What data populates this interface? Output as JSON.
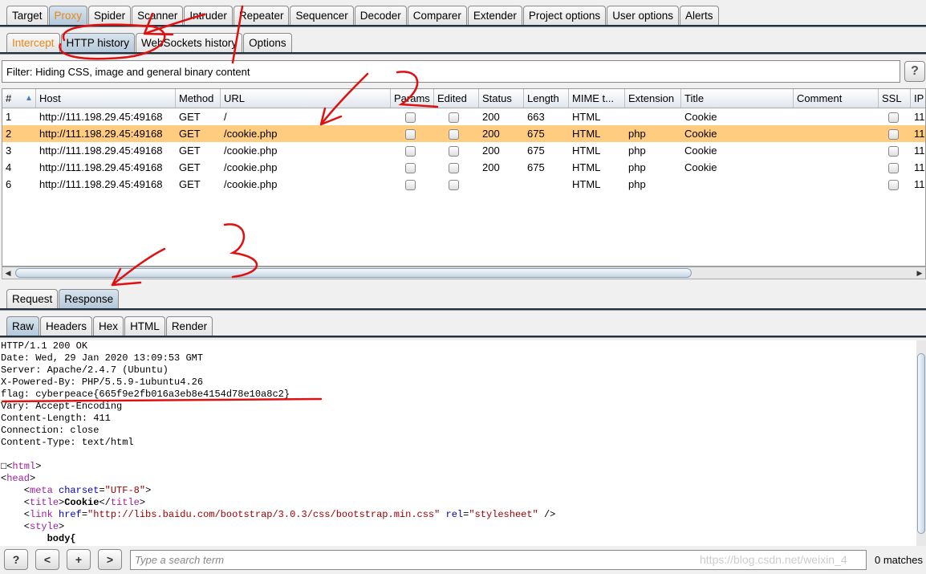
{
  "main_tabs": [
    "Target",
    "Proxy",
    "Spider",
    "Scanner",
    "Intruder",
    "Repeater",
    "Sequencer",
    "Decoder",
    "Comparer",
    "Extender",
    "Project options",
    "User options",
    "Alerts"
  ],
  "proxy_tabs": [
    "Intercept",
    "HTTP history",
    "WebSockets history",
    "Options"
  ],
  "filter": "Filter: Hiding CSS, image and general binary content",
  "help": "?",
  "columns": [
    "#",
    "Host",
    "Method",
    "URL",
    "Params",
    "Edited",
    "Status",
    "Length",
    "MIME t...",
    "Extension",
    "Title",
    "Comment",
    "SSL",
    "IP"
  ],
  "sort_indicator": "▲",
  "rows": [
    {
      "num": "1",
      "host": "http://111.198.29.45:49168",
      "method": "GET",
      "url": "/",
      "status": "200",
      "length": "663",
      "mime": "HTML",
      "ext": "",
      "title": "Cookie",
      "ip": "11"
    },
    {
      "num": "2",
      "host": "http://111.198.29.45:49168",
      "method": "GET",
      "url": "/cookie.php",
      "status": "200",
      "length": "675",
      "mime": "HTML",
      "ext": "php",
      "title": "Cookie",
      "ip": "11"
    },
    {
      "num": "3",
      "host": "http://111.198.29.45:49168",
      "method": "GET",
      "url": "/cookie.php",
      "status": "200",
      "length": "675",
      "mime": "HTML",
      "ext": "php",
      "title": "Cookie",
      "ip": "11"
    },
    {
      "num": "4",
      "host": "http://111.198.29.45:49168",
      "method": "GET",
      "url": "/cookie.php",
      "status": "200",
      "length": "675",
      "mime": "HTML",
      "ext": "php",
      "title": "Cookie",
      "ip": "11"
    },
    {
      "num": "6",
      "host": "http://111.198.29.45:49168",
      "method": "GET",
      "url": "/cookie.php",
      "status": "",
      "length": "",
      "mime": "HTML",
      "ext": "php",
      "title": "",
      "ip": "11"
    }
  ],
  "selected_row": 1,
  "msg_tabs": [
    "Request",
    "Response"
  ],
  "view_tabs": [
    "Raw",
    "Headers",
    "Hex",
    "HTML",
    "Render"
  ],
  "response_headers": [
    "HTTP/1.1 200 OK",
    "Date: Wed, 29 Jan 2020 13:09:53 GMT",
    "Server: Apache/2.4.7 (Ubuntu)",
    "X-Powered-By: PHP/5.5.9-1ubuntu4.26",
    "flag: cyberpeace{665f9e2fb016a3eb8e4154d78e10a8c2}",
    "Vary: Accept-Encoding",
    "Content-Length: 411",
    "Connection: close",
    "Content-Type: text/html"
  ],
  "body": {
    "html": "html",
    "head": "head",
    "meta": "meta",
    "charset": "charset",
    "utf8": "\"UTF-8\"",
    "title": "title",
    "title_text": "Cookie",
    "link": "link",
    "href": "href",
    "href_val": "\"http://libs.baidu.com/bootstrap/3.0.3/css/bootstrap.min.css\"",
    "rel": "rel",
    "rel_val": "\"stylesheet\"",
    "style": "style",
    "body_sel": "body{"
  },
  "search": {
    "placeholder": "Type a search term",
    "prev": "<",
    "next": ">",
    "add": "+",
    "help": "?"
  },
  "matches": "0 matches",
  "watermark": "https://blog.csdn.net/weixin_4",
  "colors": {
    "accent_orange": "#e8861a",
    "selected_row": "#ffcc80",
    "annotation": "#e01010"
  }
}
